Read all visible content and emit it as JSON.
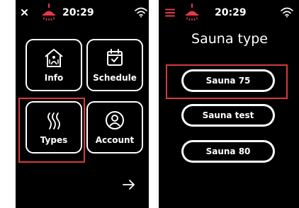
{
  "colors": {
    "screen_bg": "#000000",
    "foreground": "#ffffff",
    "accent_red": "#e5384d",
    "highlight": "#d63b3b"
  },
  "left_screen": {
    "status": {
      "time": "20:29",
      "close_icon": "close-icon",
      "heater_icon": "heater-icon",
      "wifi_icon": "wifi-icon"
    },
    "tiles": [
      {
        "label": "Info",
        "icon": "sauna-house-icon"
      },
      {
        "label": "Schedule",
        "icon": "calendar-icon"
      },
      {
        "label": "Types",
        "icon": "heat-waves-icon"
      },
      {
        "label": "Account",
        "icon": "user-icon"
      }
    ],
    "next_icon": "arrow-right-icon",
    "highlighted": "Types"
  },
  "right_screen": {
    "status": {
      "time": "20:29",
      "menu_icon": "menu-icon",
      "heater_icon": "heater-icon",
      "wifi_icon": "wifi-icon"
    },
    "title": "Sauna type",
    "sauna_types": [
      "Sauna 75",
      "Sauna test",
      "Sauna 80"
    ],
    "highlighted": "Sauna 75"
  }
}
